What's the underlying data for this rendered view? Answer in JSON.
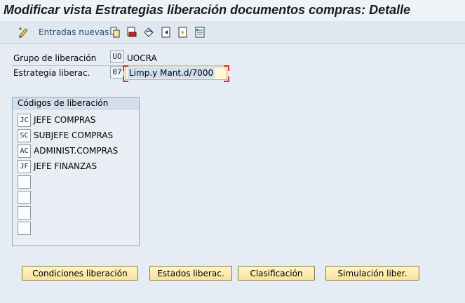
{
  "window": {
    "title": "Modificar vista Estrategias liberación documentos compras: Detalle"
  },
  "toolbar": {
    "new_entries_label": "Entradas nuevas",
    "icons": [
      "edit-icon",
      "copy-icon",
      "delete-icon",
      "undo-icon",
      "previous-entry-icon",
      "next-entry-icon",
      "variable-list-icon"
    ]
  },
  "form": {
    "release_group_label": "Grupo de liberación",
    "release_group_code": "UO",
    "release_group_value": "UOCRA",
    "strategy_label": "Estrategia liberac.",
    "strategy_code": "07",
    "strategy_value": "Limp.y Mant.d/7000"
  },
  "release_codes": {
    "title": "Códigos de liberación",
    "rows": [
      {
        "code": "JC",
        "desc": "JEFE COMPRAS"
      },
      {
        "code": "SC",
        "desc": "SUBJEFE COMPRAS"
      },
      {
        "code": "AC",
        "desc": "ADMINIST.COMPRAS"
      },
      {
        "code": "JF",
        "desc": "JEFE FINANZAS"
      },
      {
        "code": "",
        "desc": ""
      },
      {
        "code": "",
        "desc": ""
      },
      {
        "code": "",
        "desc": ""
      },
      {
        "code": "",
        "desc": ""
      }
    ]
  },
  "buttons": {
    "conditions": "Condiciones liberación",
    "states": "Estados liberac.",
    "classification": "Clasificación",
    "simulation": "Simulación liber."
  }
}
